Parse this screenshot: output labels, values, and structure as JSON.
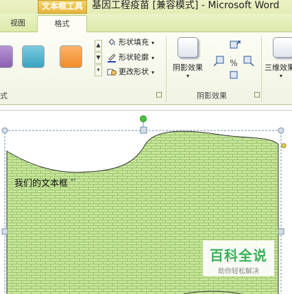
{
  "title_bar": {
    "context_group": "文本框工具",
    "document_title": "基因工程疫苗 [兼容模式] - Microsoft Word"
  },
  "tabs": [
    {
      "label": "视图"
    },
    {
      "label": "格式",
      "active": true
    }
  ],
  "ribbon": {
    "styles_group": {
      "label": "式",
      "swatch_colors": [
        "#8a5fb0",
        "#4bacc6",
        "#f79646"
      ],
      "commands": [
        {
          "label": "形状填充",
          "icon": "paint-bucket-icon"
        },
        {
          "label": "形状轮廓",
          "icon": "pen-outline-icon"
        },
        {
          "label": "更改形状",
          "icon": "change-shape-icon"
        }
      ]
    },
    "shadow_group": {
      "label": "阴影效果",
      "button_label": "阴影效果"
    },
    "threed_group": {
      "button_label": "三维效果"
    }
  },
  "document": {
    "textbox_text": "我们的文本框",
    "shape_fill": "#c6e79a",
    "brick_line": "#9cbf6e",
    "watermark": {
      "title": "百科全说",
      "subtitle": "助你轻松解决",
      "color": "#3ab05a"
    }
  }
}
